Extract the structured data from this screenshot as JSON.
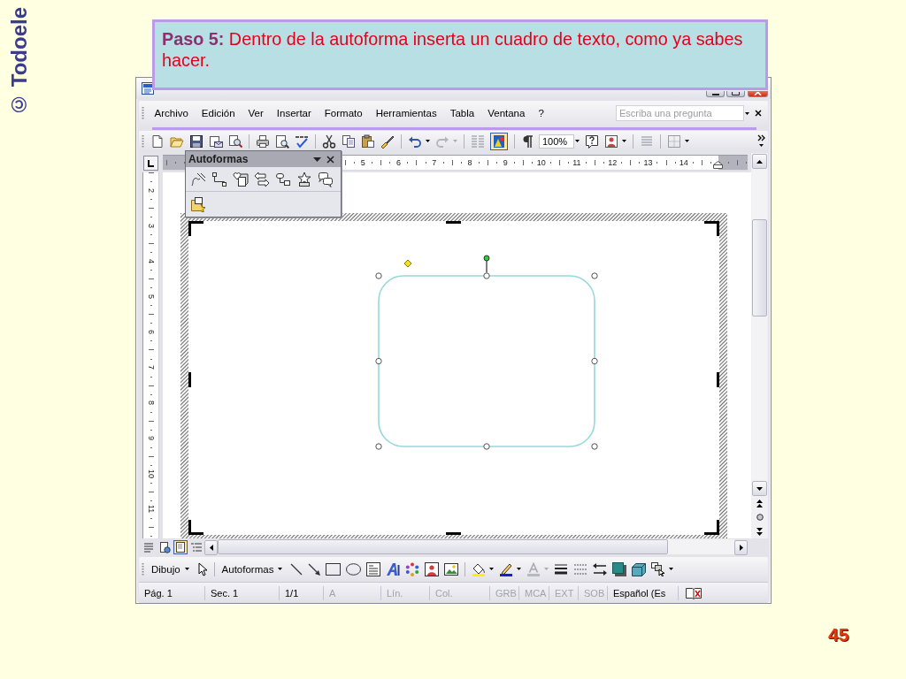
{
  "slide": {
    "brand": "© Todoele",
    "page_number": "45"
  },
  "callout": {
    "text": "**Paso 5:** Dentro de la autoforma inserta un cuadro de texto, como ya sabes hacer."
  },
  "menu_bar": [
    {
      "label": "Archivo"
    },
    {
      "label": "Edición"
    },
    {
      "label": "Ver"
    },
    {
      "label": "Insertar"
    },
    {
      "label": "Formato"
    },
    {
      "label": "Herramientas"
    },
    {
      "label": "Tabla"
    },
    {
      "label": "Ventana"
    },
    {
      "label": "?"
    }
  ],
  "help_search": {
    "placeholder": "Escriba una pregunta"
  },
  "standard_toolbar": {
    "undo": {
      "disabled": false
    },
    "redo": {
      "disabled": true
    },
    "drawing": {
      "on": true
    },
    "zoom": {
      "value": "100%"
    }
  },
  "horizontal_ruler": {
    "numbers": [
      "5",
      "6",
      "7",
      "8",
      "9",
      "10",
      "11",
      "12",
      "13",
      "14"
    ]
  },
  "vertical_ruler": {
    "numbers": [
      "2",
      "3",
      "4",
      "5",
      "6",
      "7",
      "8",
      "9",
      "10",
      "11"
    ]
  },
  "autoshapes_panel": {
    "title": "Autoformas"
  },
  "view_buttons": [
    {
      "selected": false
    },
    {
      "selected": false
    },
    {
      "selected": true
    },
    {
      "selected": false
    }
  ],
  "drawing_toolbar": {
    "draw_menu": {
      "label": "Dibujo"
    },
    "autoshapes_menu": {
      "label": "Autoformas"
    },
    "font_color": {
      "disabled": true
    }
  },
  "status_bar": [
    {
      "text": "Pág. 1",
      "disabled": false
    },
    {
      "text": "Sec. 1",
      "disabled": false
    },
    {
      "text": "1/1",
      "disabled": false
    },
    {
      "text": "A",
      "disabled": true
    },
    {
      "text": "Lín.",
      "disabled": true
    },
    {
      "text": "Col.",
      "disabled": true
    },
    {
      "text": "GRB",
      "disabled": true
    },
    {
      "text": "MCA",
      "disabled": true
    },
    {
      "text": "EXT",
      "disabled": true
    },
    {
      "text": "SOB",
      "disabled": true
    },
    {
      "text": "Español (Es",
      "disabled": false
    }
  ]
}
